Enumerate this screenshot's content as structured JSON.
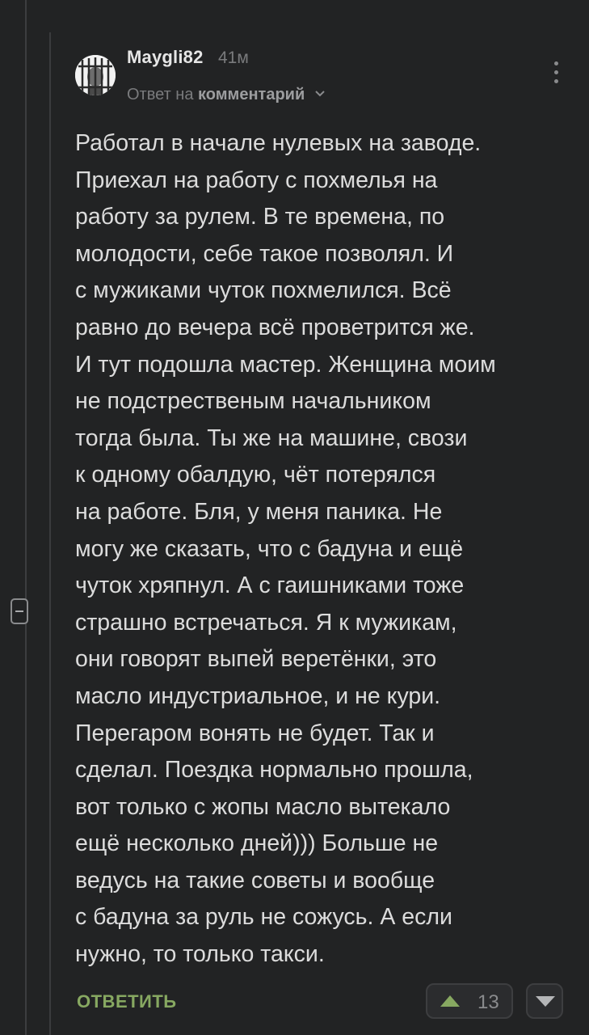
{
  "comment": {
    "author": "Maygli82",
    "time": "41м",
    "reply_prefix": "Ответ на",
    "reply_link": "комментарий",
    "body_lines": [
      "Работал в начале нулевых на заводе.",
      "Приехал на работу с похмелья на",
      "работу за рулем. В те времена, по",
      "молодости, себе такое позволял. И",
      "с мужиками чуток похмелился. Всё",
      "равно до вечера всё проветрится же.",
      "И тут подошла мастер. Женщина моим",
      "не подстрественым начальником",
      "тогда была. Ты же на машине, свози",
      "к одному обалдую, чёт потерялся",
      "на работе. Бля, у меня паника. Не",
      "могу же сказать, что с бадуна и ещё",
      "чуток хряпнул. А с гаишниками тоже",
      "страшно встречаться. Я к мужикам,",
      "они говорят выпей веретёнки, это",
      "масло индустриальное, и не кури.",
      "Перегаром вонять не будет. Так и",
      "сделал. Поездка нормально прошла,",
      "вот только с жопы масло вытекало",
      "ещё несколько дней))) Больше не",
      "ведусь на такие советы и вообще",
      "с бадуна за руль не сожусь. А если",
      "нужно, то только такси."
    ],
    "reply_button": "ОТВЕТИТЬ",
    "rating": "13"
  },
  "icons": {
    "avatar": "prisoner-avatar-icon",
    "more": "more-vertical-icon",
    "chevron": "chevron-down-icon",
    "upvote": "upvote-icon",
    "downvote": "downvote-icon",
    "collapse": "collapse-icon"
  },
  "colors": {
    "background": "#222324",
    "text": "#dcdcdc",
    "muted": "#7a7b7d",
    "accent_green": "#87a861"
  }
}
